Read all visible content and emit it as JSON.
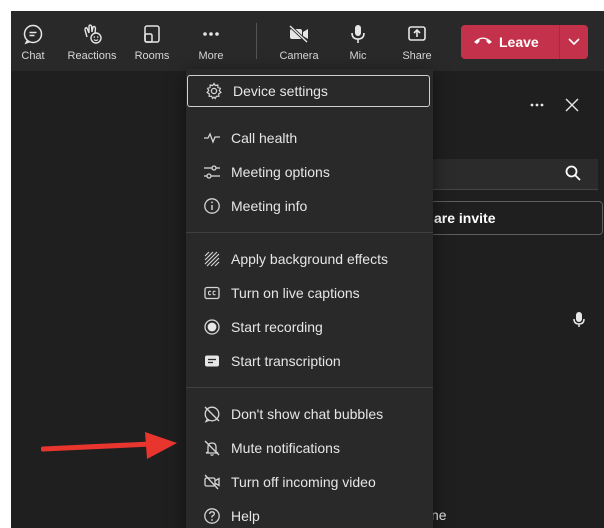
{
  "toolbar": {
    "chat": "Chat",
    "reactions": "Reactions",
    "rooms": "Rooms",
    "more": "More",
    "camera": "Camera",
    "mic": "Mic",
    "share": "Share",
    "leave": "Leave"
  },
  "panel": {
    "share_invite": "are invite",
    "name_fragment": "ne"
  },
  "menu": {
    "items": [
      {
        "label": "Device settings",
        "icon": "gear-icon"
      },
      {
        "label": "Call health",
        "icon": "pulse-icon"
      },
      {
        "label": "Meeting options",
        "icon": "sliders-icon"
      },
      {
        "label": "Meeting info",
        "icon": "info-icon"
      },
      {
        "label": "Apply background effects",
        "icon": "background-effects-icon"
      },
      {
        "label": "Turn on live captions",
        "icon": "captions-icon"
      },
      {
        "label": "Start recording",
        "icon": "record-icon"
      },
      {
        "label": "Start transcription",
        "icon": "transcript-icon"
      },
      {
        "label": "Don't show chat bubbles",
        "icon": "chat-bubble-off-icon"
      },
      {
        "label": "Mute notifications",
        "icon": "bell-off-icon"
      },
      {
        "label": "Turn off incoming video",
        "icon": "video-off-icon"
      },
      {
        "label": "Help",
        "icon": "help-icon"
      }
    ]
  },
  "colors": {
    "leave": "#c4314b",
    "toolbar_bg": "#292929",
    "menu_bg": "#292929",
    "stage_bg": "#1f1f1f",
    "annotation_arrow": "#e8352e"
  }
}
